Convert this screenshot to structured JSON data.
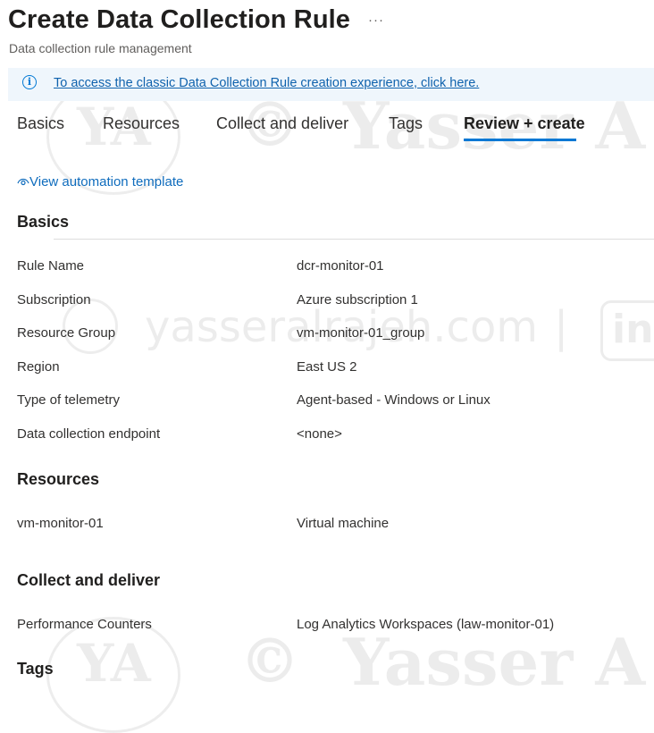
{
  "header": {
    "title": "Create Data Collection Rule",
    "more_icon": "ellipsis-icon",
    "subtitle": "Data collection rule management"
  },
  "banner": {
    "icon": "info-icon",
    "link_text": "To access the classic Data Collection Rule creation experience, click here."
  },
  "tabs": [
    {
      "label": "Basics",
      "active": false
    },
    {
      "label": "Resources",
      "active": false
    },
    {
      "label": "Collect and deliver",
      "active": false
    },
    {
      "label": "Tags",
      "active": false
    },
    {
      "label": "Review + create",
      "active": true
    }
  ],
  "automation_link": {
    "icon": "eye-icon",
    "label": "View automation template"
  },
  "sections": {
    "basics": {
      "heading": "Basics",
      "rows": [
        {
          "label": "Rule Name",
          "value": "dcr-monitor-01"
        },
        {
          "label": "Subscription",
          "value": "Azure subscription 1"
        },
        {
          "label": "Resource Group",
          "value": "vm-monitor-01_group"
        },
        {
          "label": "Region",
          "value": "East US 2"
        },
        {
          "label": "Type of telemetry",
          "value": "Agent-based - Windows or Linux"
        },
        {
          "label": "Data collection endpoint",
          "value": "<none>"
        }
      ]
    },
    "resources": {
      "heading": "Resources",
      "rows": [
        {
          "label": "vm-monitor-01",
          "value": "Virtual machine"
        }
      ]
    },
    "collect_deliver": {
      "heading": "Collect and deliver",
      "rows": [
        {
          "label": "Performance Counters",
          "value": "Log Analytics Workspaces (law-monitor-01)"
        }
      ]
    },
    "tags": {
      "heading": "Tags"
    }
  },
  "watermark": {
    "site": "yasseralrajeh.com",
    "name": "Yasser A",
    "monogram": "YA",
    "copyright": "©",
    "separator": "|",
    "linkedin": "in"
  },
  "colors": {
    "accent": "#0078d4",
    "link": "#0f6cbd",
    "banner_bg": "#eff6fc"
  }
}
